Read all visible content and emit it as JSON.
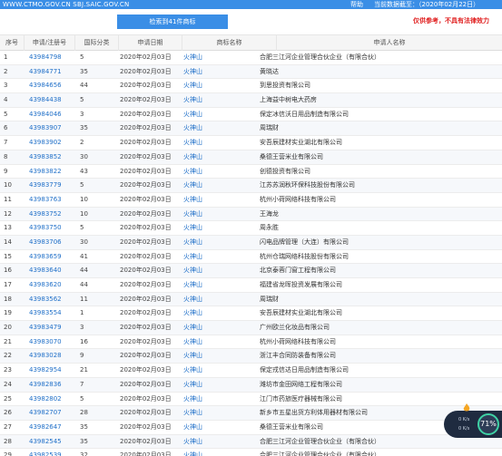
{
  "topbar": {
    "url_text": "WWW.CTMO.GOV.CN SBJ.SAIC.GOV.CN",
    "help": "帮助",
    "data_cutoff": "当前数据截至：（2020年02月22日）"
  },
  "summary": {
    "result_count": "检索到41件商标",
    "disclaimer": "仅供参考，不具有法律效力"
  },
  "table": {
    "headers": [
      "序号",
      "申请/注册号",
      "国际分类",
      "申请日期",
      "商标名称",
      "申请人名称"
    ],
    "rows": [
      [
        "1",
        "43984798",
        "5",
        "2020年02月03日",
        "火神山",
        "合肥三江河企业管理合伙企业（有限合伙）"
      ],
      [
        "2",
        "43984771",
        "35",
        "2020年02月03日",
        "火神山",
        "黄晓达"
      ],
      [
        "3",
        "43984656",
        "44",
        "2020年02月03日",
        "火神山",
        "到思投资有限公司"
      ],
      [
        "4",
        "43984438",
        "5",
        "2020年02月03日",
        "火神山",
        "上海益中树电大药房"
      ],
      [
        "5",
        "43984046",
        "3",
        "2020年02月03日",
        "火神山",
        "保定冰信沃日用品制造有限公司"
      ],
      [
        "6",
        "43983907",
        "35",
        "2020年02月03日",
        "火神山",
        "周瑞财"
      ],
      [
        "7",
        "43983902",
        "2",
        "2020年02月03日",
        "火神山",
        "安吾辰建材实业湖北有限公司"
      ],
      [
        "8",
        "43983852",
        "30",
        "2020年02月03日",
        "火神山",
        "桑德王营米业有限公司"
      ],
      [
        "9",
        "43983822",
        "43",
        "2020年02月03日",
        "火神山",
        "创德投资有限公司"
      ],
      [
        "10",
        "43983779",
        "5",
        "2020年02月03日",
        "火神山",
        "江苏苏润秋环保科技股份有限公司"
      ],
      [
        "11",
        "43983763",
        "10",
        "2020年02月03日",
        "火神山",
        "杭州小荷网络科技有限公司"
      ],
      [
        "12",
        "43983752",
        "10",
        "2020年02月03日",
        "火神山",
        "王海龙"
      ],
      [
        "13",
        "43983750",
        "5",
        "2020年02月03日",
        "火神山",
        "周永胜"
      ],
      [
        "14",
        "43983706",
        "30",
        "2020年02月03日",
        "火神山",
        "闪电品牌管理（大连）有限公司"
      ],
      [
        "15",
        "43983659",
        "41",
        "2020年02月03日",
        "火神山",
        "杭州仓瑞网络科技股份有限公司"
      ],
      [
        "16",
        "43983640",
        "44",
        "2020年02月03日",
        "火神山",
        "北京泰蓉门窗工程有限公司"
      ],
      [
        "17",
        "43983620",
        "44",
        "2020年02月03日",
        "火神山",
        "福建省龙晖投资发展有限公司"
      ],
      [
        "18",
        "43983562",
        "11",
        "2020年02月03日",
        "火神山",
        "周瑞财"
      ],
      [
        "19",
        "43983554",
        "1",
        "2020年02月03日",
        "火神山",
        "安吾辰建材实业湖北有限公司"
      ],
      [
        "20",
        "43983479",
        "3",
        "2020年02月03日",
        "火神山",
        "广州欧兰化妆品有限公司"
      ],
      [
        "21",
        "43983070",
        "16",
        "2020年02月03日",
        "火神山",
        "杭州小荷网络科技有限公司"
      ],
      [
        "22",
        "43983028",
        "9",
        "2020年02月03日",
        "火神山",
        "浙江丰合同防装备有限公司"
      ],
      [
        "23",
        "43982954",
        "21",
        "2020年02月03日",
        "火神山",
        "保定戎信达日用品制造有限公司"
      ],
      [
        "24",
        "43982836",
        "7",
        "2020年02月03日",
        "火神山",
        "潍坊市金田网络工程有限公司"
      ],
      [
        "25",
        "43982802",
        "5",
        "2020年02月03日",
        "火神山",
        "江门市药旅医疗器械有限公司"
      ],
      [
        "26",
        "43982707",
        "28",
        "2020年02月03日",
        "火神山",
        "新乡市五星出货方利体用器材有限公司"
      ],
      [
        "27",
        "43982647",
        "35",
        "2020年02月03日",
        "火神山",
        "桑德王营米业有限公司"
      ],
      [
        "28",
        "43982545",
        "35",
        "2020年02月03日",
        "火神山",
        "合肥三江河企业管理合伙企业（有限合伙）"
      ],
      [
        "29",
        "43982539",
        "32",
        "2020年02月03日",
        "火神山",
        "合肥三江河企业管理合伙企业（有限合伙）"
      ]
    ]
  },
  "widget": {
    "upload": "0 K/s",
    "download": "0 K/s",
    "percent": "71%"
  }
}
